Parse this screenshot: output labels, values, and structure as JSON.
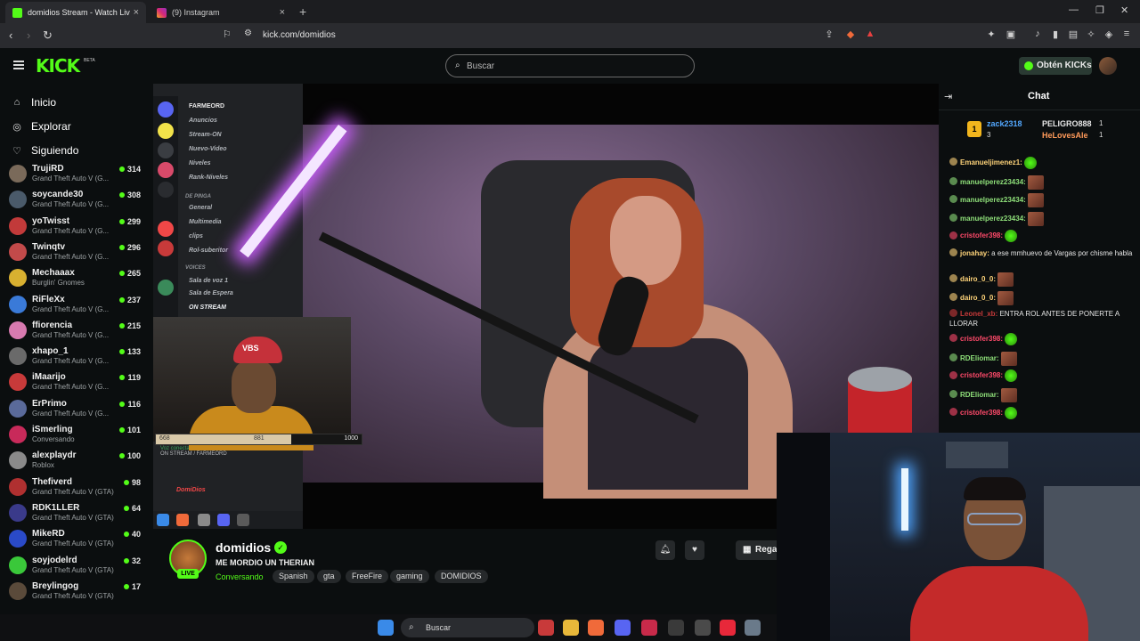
{
  "browser": {
    "tabs": [
      {
        "label": "domidios Stream - Watch Liv",
        "active": true
      },
      {
        "label": "(9) Instagram",
        "active": false
      }
    ],
    "url": "kick.com/domidios"
  },
  "header": {
    "logo": "KICK",
    "beta": "BETA",
    "search_placeholder": "Buscar",
    "get_kicks": "Obtén KICKs"
  },
  "sidebar": {
    "nav": [
      {
        "label": "Inicio",
        "icon": "home-icon"
      },
      {
        "label": "Explorar",
        "icon": "compass-icon"
      },
      {
        "label": "Siguiendo",
        "icon": "heart-icon"
      }
    ],
    "channels": [
      {
        "name": "TrujiRD",
        "game": "Grand Theft Auto V (G...",
        "viewers": "314",
        "color": "#7a6a5a"
      },
      {
        "name": "soycande30",
        "game": "Grand Theft Auto V (G...",
        "viewers": "308",
        "color": "#4a5a6a"
      },
      {
        "name": "yoTwisst",
        "game": "Grand Theft Auto V (G...",
        "viewers": "299",
        "color": "#c23a3a"
      },
      {
        "name": "Twinqtv",
        "game": "Grand Theft Auto V (G...",
        "viewers": "296",
        "color": "#c24a4a"
      },
      {
        "name": "Mechaaax",
        "game": "Burglin' Gnomes",
        "viewers": "265",
        "color": "#d8b030"
      },
      {
        "name": "RiFleXx",
        "game": "Grand Theft Auto V (G...",
        "viewers": "237",
        "color": "#3a7ad8"
      },
      {
        "name": "ffiorencia",
        "game": "Grand Theft Auto V (G...",
        "viewers": "215",
        "color": "#d87ab0"
      },
      {
        "name": "xhapo_1",
        "game": "Grand Theft Auto V (G...",
        "viewers": "133",
        "color": "#6a6a6a"
      },
      {
        "name": "iMaarijo",
        "game": "Grand Theft Auto V (G...",
        "viewers": "119",
        "color": "#c83a3a"
      },
      {
        "name": "ErPrimo",
        "game": "Grand Theft Auto V (G...",
        "viewers": "116",
        "color": "#5a6a9a"
      },
      {
        "name": "iSmerling",
        "game": "Conversando",
        "viewers": "101",
        "color": "#c82a5a"
      },
      {
        "name": "alexplaydr",
        "game": "Roblox",
        "viewers": "100",
        "color": "#8a8a8a"
      },
      {
        "name": "Thefiverd",
        "game": "Grand Theft Auto V (GTA)",
        "viewers": "98",
        "color": "#b03030"
      },
      {
        "name": "RDK1LLER",
        "game": "Grand Theft Auto V (GTA)",
        "viewers": "64",
        "color": "#3a3a8a"
      },
      {
        "name": "MikeRD",
        "game": "Grand Theft Auto V (GTA)",
        "viewers": "40",
        "color": "#2a4ac8"
      },
      {
        "name": "soyjodelrd",
        "game": "Grand Theft Auto V (GTA)",
        "viewers": "32",
        "color": "#3ac83a"
      },
      {
        "name": "Breylingog",
        "game": "Grand Theft Auto V (GTA)",
        "viewers": "17",
        "color": "#5a4a3a"
      }
    ]
  },
  "video": {
    "discord": {
      "server": "FARMEORD",
      "window_title": "FARMEORD",
      "channels": [
        "Anuncios",
        "Stream-ON",
        "Nuevo-Video",
        "Niveles",
        "Rank-Niveles",
        "DE PINGA",
        "General",
        "Multimedia",
        "clips",
        "Rol-suberitor",
        "VOICES",
        "Sala de voz 1",
        "Sala de Espera",
        "ON STREAM"
      ],
      "voice_status": "Voz conectada",
      "voice_channel": "ON STREAM / FARMEORD",
      "user": "DomiDios"
    },
    "facecam_hat": "VBS",
    "progress": {
      "left": "668",
      "mid": "881",
      "right": "1000",
      "fraction": 0.66
    }
  },
  "stream_info": {
    "channel": "domidios",
    "title": "ME MORDIO UN THERIAN",
    "category": "Conversando",
    "live_label": "LIVE",
    "tags": [
      "Spanish",
      "gta",
      "FreeFire",
      "gaming",
      "DOMIDIOS"
    ],
    "gift_label": "Regala Su"
  },
  "chat": {
    "title": "Chat",
    "leaderboard": [
      {
        "name": "zack2318",
        "sub": "3",
        "color": "#53a8ff"
      },
      {
        "name": "PELIGRO888",
        "sub": "1",
        "color": "#e6e6e6"
      },
      {
        "name": "HeLovesAle",
        "sub": "1",
        "color": "#ff9a5a"
      }
    ],
    "messages": [
      {
        "user": "Emanueljimenez1:",
        "text": "",
        "color": "#ffd47a",
        "emotes": 1,
        "green": true
      },
      {
        "user": "manuelperez23434:",
        "text": "",
        "color": "#8fe07a",
        "emotes": 1,
        "green": false
      },
      {
        "user": "manuelperez23434:",
        "text": "",
        "color": "#8fe07a",
        "emotes": 1,
        "green": false
      },
      {
        "user": "manuelperez23434:",
        "text": "",
        "color": "#8fe07a",
        "emotes": 1,
        "green": false
      },
      {
        "user": "cristofer398:",
        "text": "",
        "color": "#ff4a6a",
        "emotes": 1,
        "green": true
      },
      {
        "user": "jonahay:",
        "text": "a ese mmhuevo de Vargas por chisme habla",
        "color": "#ffd47a",
        "emotes": 0,
        "green": false
      },
      {
        "user": "dairo_0_0:",
        "text": "",
        "color": "#ffd47a",
        "emotes": 1,
        "green": false
      },
      {
        "user": "dairo_0_0:",
        "text": "",
        "color": "#ffd47a",
        "emotes": 1,
        "green": false
      },
      {
        "user": "Leonel_xb:",
        "text": "ENTRA ROL ANTES DE PONERTE A LLORAR",
        "color": "#c83a3a",
        "emotes": 0,
        "green": false
      },
      {
        "user": "cristofer398:",
        "text": "",
        "color": "#ff4a6a",
        "emotes": 1,
        "green": true
      },
      {
        "user": "RDEliomar:",
        "text": "",
        "color": "#8fe07a",
        "emotes": 1,
        "green": false
      },
      {
        "user": "cristofer398:",
        "text": "",
        "color": "#ff4a6a",
        "emotes": 1,
        "green": true
      },
      {
        "user": "RDEliomar:",
        "text": "",
        "color": "#8fe07a",
        "emotes": 1,
        "green": false
      },
      {
        "user": "cristofer398:",
        "text": "",
        "color": "#ff4a6a",
        "emotes": 1,
        "green": true
      }
    ]
  },
  "taskbar": {
    "search": "Buscar"
  },
  "colors": {
    "accent": "#53fc18",
    "background": "#0b0e0f"
  }
}
